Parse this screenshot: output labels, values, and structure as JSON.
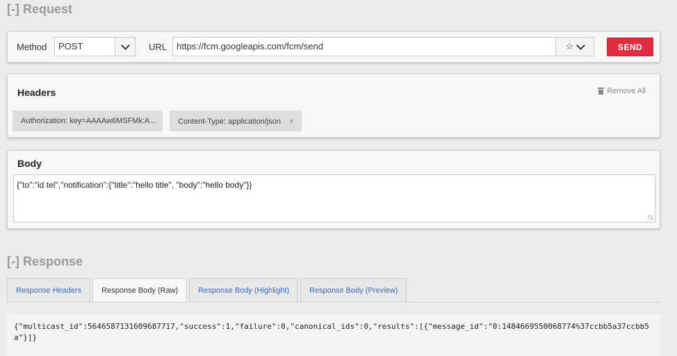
{
  "request": {
    "section_title": "[-] Request",
    "method_label": "Method",
    "method_value": "POST",
    "url_label": "URL",
    "url_value": "https://fcm.googleapis.com/fcm/send",
    "send_label": "SEND"
  },
  "headers": {
    "title": "Headers",
    "remove_all": "Remove All",
    "items": [
      {
        "text": "Authorization: key=AAAAw6MSFMk:A..."
      },
      {
        "text": "Content-Type: application/json",
        "close": "×"
      }
    ]
  },
  "body": {
    "title": "Body",
    "content": "{\"to\":\"id tel\",\"notification\":{\"title\":\"hello title\", \"body\":\"hello body\"}}"
  },
  "response": {
    "section_title": "[-] Response",
    "tabs": [
      {
        "label": "Response Headers",
        "active": false
      },
      {
        "label": "Response Body (Raw)",
        "active": true
      },
      {
        "label": "Response Body (Highlight)",
        "active": false
      },
      {
        "label": "Response Body (Preview)",
        "active": false
      }
    ],
    "raw_body": "{\"multicast_id\":5646587131609687717,\"success\":1,\"failure\":0,\"canonical_ids\":0,\"results\":[{\"message_id\":\"0:1484669550068774%37ccbb5a37ccbb5a\"}]}"
  },
  "icons": {
    "star": "star-icon",
    "chevron": "chevron-down-icon",
    "trash": "trash-icon"
  },
  "colors": {
    "send": "#e32d3f",
    "link": "#3b6cc6",
    "section_title": "#9a9a9a"
  }
}
